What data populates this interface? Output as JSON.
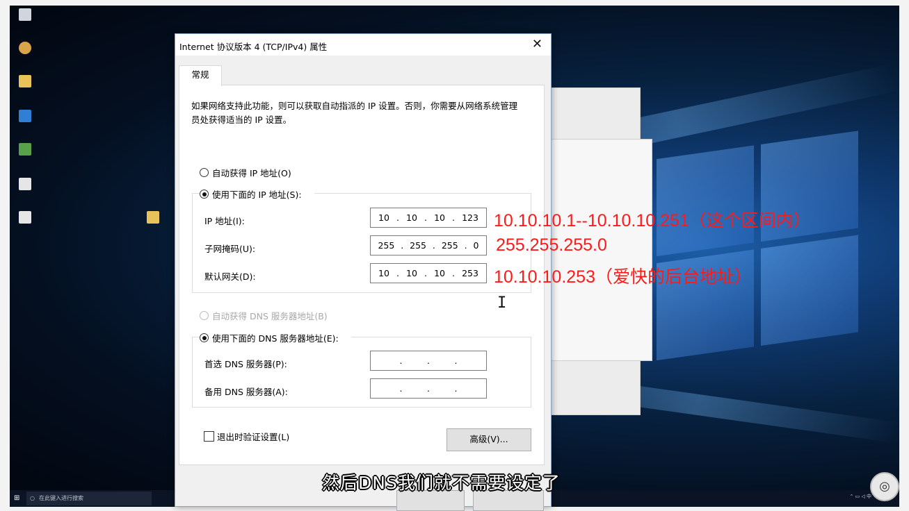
{
  "dialog": {
    "title": "Internet 协议版本 4 (TCP/IPv4) 属性",
    "close_glyph": "✕",
    "tab_general": "常规",
    "description": "如果网络支持此功能，则可以获取自动指派的 IP 设置。否则，你需要从网络系统管理员处获得适当的 IP 设置。",
    "auto_ip_label": "自动获得 IP 地址(O)",
    "use_ip_label": "使用下面的 IP 地址(S):",
    "ip_address_label": "IP 地址(I):",
    "subnet_label": "子网掩码(U):",
    "gateway_label": "默认网关(D):",
    "ip_address": [
      "10",
      "10",
      "10",
      "123"
    ],
    "subnet_mask": [
      "255",
      "255",
      "255",
      "0"
    ],
    "gateway": [
      "10",
      "10",
      "10",
      "253"
    ],
    "auto_dns_label": "自动获得 DNS 服务器地址(B)",
    "use_dns_label": "使用下面的 DNS 服务器地址(E):",
    "preferred_dns_label": "首选 DNS 服务器(P):",
    "alternate_dns_label": "备用 DNS 服务器(A):",
    "validate_label": "退出时验证设置(L)",
    "advanced_button": "高级(V)...",
    "selected_ip_mode": "manual",
    "selected_dns_mode": "manual"
  },
  "annotations": {
    "ip_range": "10.10.10.1--10.10.10.251（这个区间内）",
    "subnet": "255.255.255.0",
    "gateway": "10.10.10.253（爱快的后台地址）",
    "color": "#ff1a1a"
  },
  "subtitle": "然后DNS我们就不需要设定了",
  "taskbar": {
    "search_placeholder": "在此键入进行搜索"
  },
  "icons": [
    "close-icon",
    "windows-logo-icon",
    "search-icon",
    "text-cursor-icon"
  ]
}
